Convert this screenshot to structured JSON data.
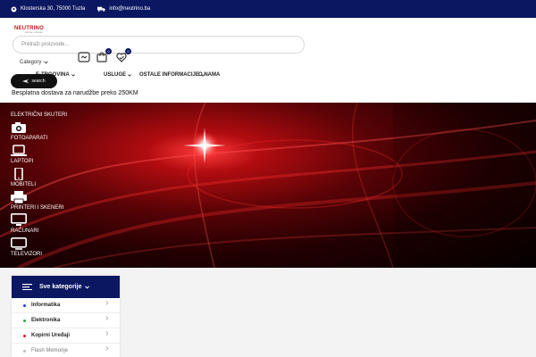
{
  "topbar": {
    "address": "Klosterska 30, 75000 Tuzla",
    "email": "info@neutrino.ba"
  },
  "header": {
    "logo_text": "NEUTRINO",
    "logo_sub": "internet · računari",
    "search_placeholder": "Pretraži proizvode...",
    "category_label": "Category",
    "cart_badge": "0",
    "wishlist_badge": "0"
  },
  "nav": {
    "items": [
      "E-TRGOVINA",
      "USLUGE",
      "OSTALE INFORMACIJE",
      "O NAMA"
    ]
  },
  "search_button": "search",
  "promo": "Besplatna dostava za narudžbe preko 250KM",
  "hero_categories": [
    "ELEKTRIČNI SKUTERI",
    "FOTOAPARATI",
    "LAPTOPI",
    "MOBITELI",
    "PRINTERI I SKENERI",
    "RAČUNARI",
    "TELEVIZORI"
  ],
  "sidebar": {
    "title": "Sve kategorije",
    "items": [
      {
        "label": "Informatika",
        "dot": "#1a3fd8"
      },
      {
        "label": "Elektronika",
        "dot": "#2fa83c"
      },
      {
        "label": "Kopirni Uređaji",
        "dot": "#d61f2c"
      },
      {
        "label": "Flash Memorije",
        "dot": "#bbbbbb"
      }
    ]
  },
  "colors": {
    "navy": "#0b1761",
    "accent_red": "#c5151c"
  }
}
